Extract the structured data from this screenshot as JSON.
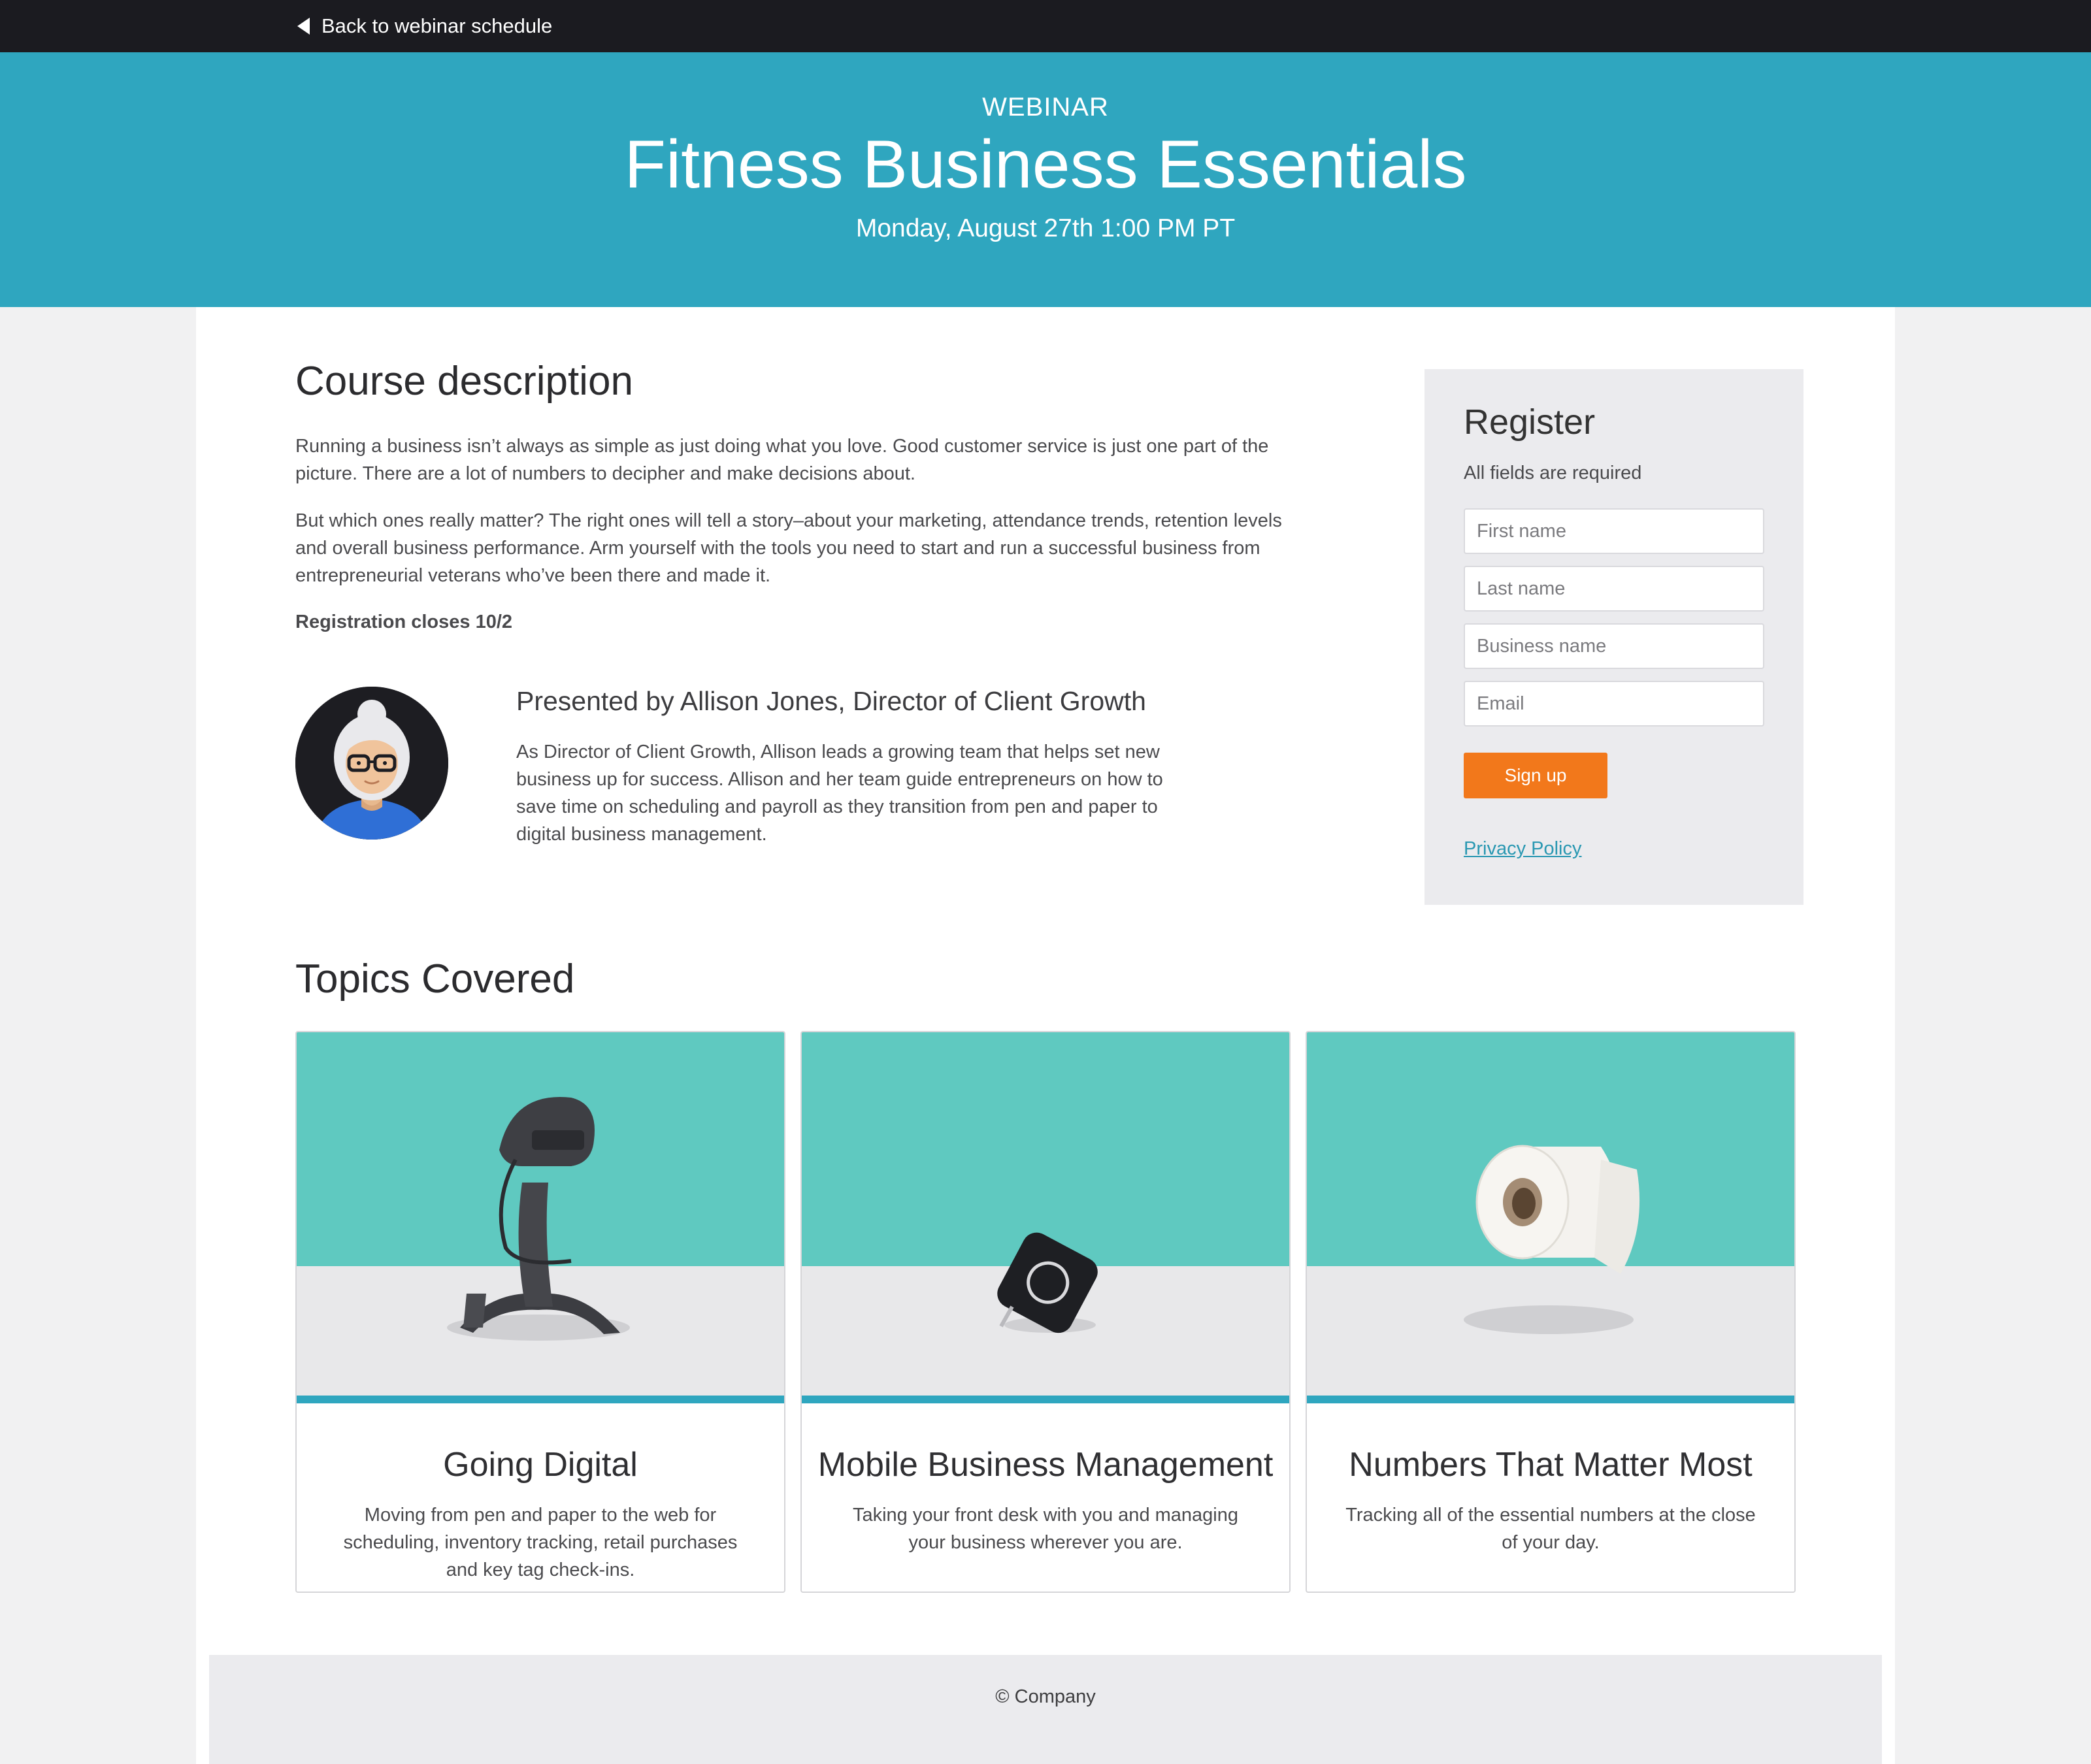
{
  "nav": {
    "back_label": "Back to webinar schedule",
    "back_icon": "caret-left-icon"
  },
  "hero": {
    "eyebrow": "WEBINAR",
    "title": "Fitness Business Essentials",
    "date": "Monday, August 27th 1:00 PM PT"
  },
  "course": {
    "heading": "Course description",
    "para1": "Running a business isn’t always as simple as just doing what you love. Good customer service is just one part of the picture. There are a lot of numbers to decipher and make decisions about.",
    "para2": "But which ones really matter? The right ones will tell a story–about your marketing, attendance trends, retention levels and overall business performance. Arm yourself with the tools you need to start and run a successful business from entrepreneurial veterans who’ve been there and made it.",
    "registration_closes": "Registration closes 10/2"
  },
  "presenter": {
    "title": "Presented by Allison Jones, Director of Client Growth",
    "bio": "As Director of Client Growth, Allison leads a growing team that helps set new business up for success. Allison and her team guide entrepreneurs on how to save time on scheduling and payroll as they transition from pen and paper to digital business management."
  },
  "register": {
    "title": "Register",
    "note": "All fields are required",
    "fields": {
      "first_name": "First name",
      "last_name": "Last name",
      "business_name": "Business name",
      "email": "Email"
    },
    "submit_label": "Sign up",
    "privacy_label": "Privacy Policy"
  },
  "topics": {
    "heading": "Topics Covered",
    "items": [
      {
        "title": "Going Digital",
        "desc": "Moving from pen and paper to the web for scheduling, inventory tracking, retail purchases and key tag check-ins."
      },
      {
        "title": "Mobile Business Management",
        "desc": "Taking your front desk with you and managing your business wherever you are."
      },
      {
        "title": "Numbers That Matter Most",
        "desc": "Tracking all of the essential numbers at the close of your day."
      }
    ]
  },
  "footer": {
    "copyright": "© Company"
  },
  "colors": {
    "hero": "#2fa6bf",
    "topbar": "#1b1b20",
    "signup_button": "#f2781b",
    "link": "#2a98b2",
    "panel": "#ebebee"
  }
}
